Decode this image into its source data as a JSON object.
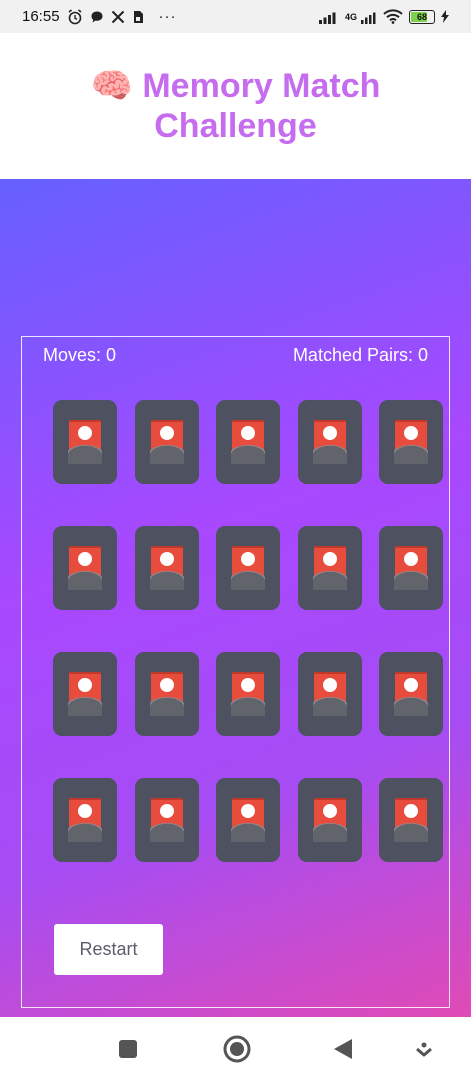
{
  "status_bar": {
    "time": "16:55",
    "network_label": "4G",
    "battery_percent": "68",
    "battery_level": 0.68,
    "more_indicator": "···",
    "icons": [
      "alarm-icon",
      "chat-icon",
      "x-logo-icon",
      "sim-icon",
      "signal-icon",
      "wifi-icon",
      "battery-icon",
      "charging-icon"
    ]
  },
  "header": {
    "emoji": "🧠",
    "title": "Memory Match Challenge"
  },
  "game": {
    "moves_label": "Moves: 0",
    "moves": 0,
    "matched_label": "Matched Pairs: 0",
    "matched_pairs": 0,
    "rows": 4,
    "columns": 5,
    "card_back_icon": "image-placeholder-icon",
    "restart_label": "Restart"
  },
  "nav_bar": {
    "buttons": [
      "recent-apps-icon",
      "home-icon",
      "back-icon",
      "assistant-icon"
    ]
  },
  "colors": {
    "title": "#c56cef",
    "gradient_start": "#6660ff",
    "gradient_mid": "#a848ff",
    "gradient_end": "#e04bb6",
    "card_back": "#4d5160",
    "card_image": "#e74c3c"
  }
}
